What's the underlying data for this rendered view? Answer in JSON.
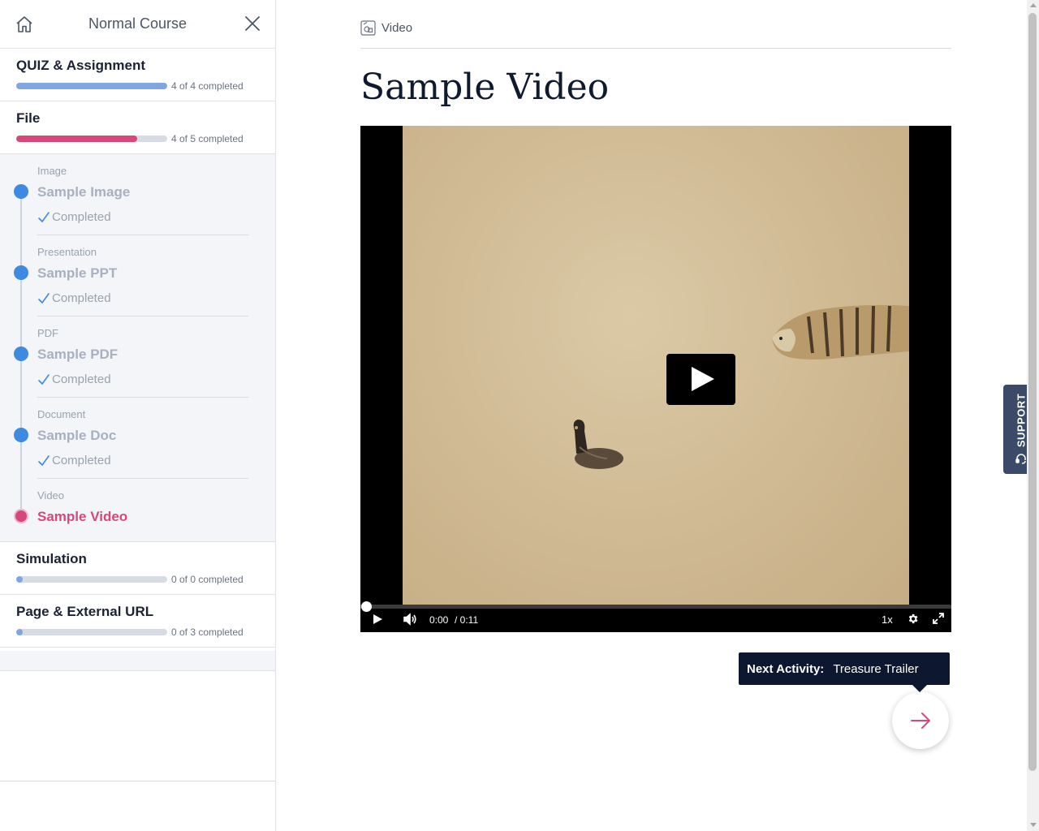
{
  "sidebar": {
    "title": "Normal Course",
    "sections_top": [
      {
        "title": "QUIZ & Assignment",
        "progress_fraction": 1.0,
        "progress_text": "4 of 4 completed",
        "color": "#7ea7df"
      },
      {
        "title": "File",
        "progress_fraction": 0.8,
        "progress_text": "4 of 5 completed",
        "color": "#d9477a"
      }
    ],
    "activities": [
      {
        "type": "Image",
        "name": "Sample Image",
        "status": "Completed"
      },
      {
        "type": "Presentation",
        "name": "Sample PPT",
        "status": "Completed"
      },
      {
        "type": "PDF",
        "name": "Sample PDF",
        "status": "Completed"
      },
      {
        "type": "Document",
        "name": "Sample Doc",
        "status": "Completed"
      },
      {
        "type": "Video",
        "name": "Sample Video",
        "current": true
      }
    ],
    "sections_bottom": [
      {
        "title": "Simulation",
        "progress_fraction": 0.0,
        "progress_text": "0 of 0 completed",
        "color": "#7ea7df"
      },
      {
        "title": "Page & External URL",
        "progress_fraction": 0.0,
        "progress_text": "0 of 3 completed",
        "color": "#7ea7df"
      }
    ]
  },
  "main": {
    "breadcrumb": "Video",
    "title": "Sample Video",
    "video": {
      "time_current": "0:00",
      "time_total": "/ 0:11",
      "speed": "1x"
    },
    "next": {
      "label": "Next Activity:",
      "name": "Treasure Trailer"
    }
  },
  "support_label": "SUPPORT",
  "colors": {
    "accent_pink": "#d9477a",
    "accent_blue": "#3d8ae0",
    "navy": "#0e1730"
  },
  "icons": [
    "home-icon",
    "close-icon",
    "video-type-icon",
    "check-icon",
    "play-icon",
    "volume-icon",
    "settings-icon",
    "fullscreen-icon",
    "arrow-right-icon",
    "headset-icon"
  ]
}
